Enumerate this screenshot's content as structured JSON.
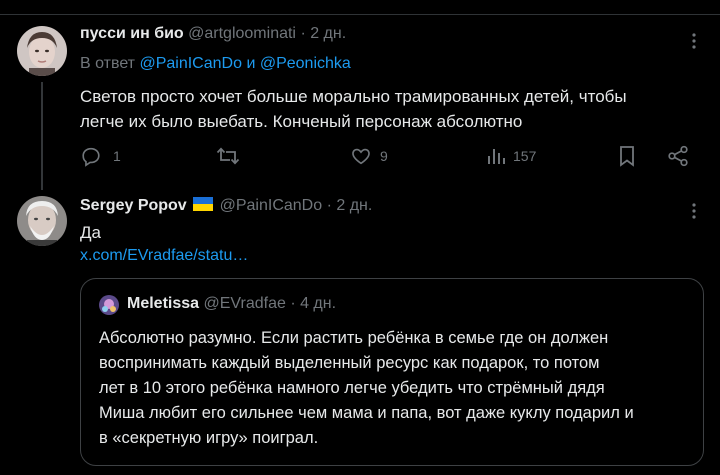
{
  "tweet1": {
    "author_name": "пусси ин био",
    "handle": "@artgloominati",
    "time": "· 2 дн.",
    "reply_prefix": "В ответ",
    "reply_user1": "@PainICanDo",
    "reply_and": "и",
    "reply_user2": "@Peonichka",
    "text_line1": "Светов просто хочет больше морально трамированных детей, чтобы",
    "text_line2": "легче их было выебать. Конченый персонаж абсолютно",
    "stats": {
      "replies": "1",
      "retweets": "",
      "likes": "9",
      "views": "157"
    }
  },
  "tweet2": {
    "author_name": "Sergey Popov",
    "handle": "@PainICanDo",
    "time": "· 2 дн.",
    "text": "Да",
    "link": "x.com/EVradfae/statu…",
    "quote": {
      "author_name": "Meletissa",
      "handle": "@EVradfae",
      "time": "· 4 дн.",
      "lines": [
        "Абсолютно разумно. Если растить ребёнка в семье где он должен",
        "воспринимать каждый выделенный ресурс как подарок, то потом",
        "лет в 10 этого ребёнка намного легче убедить что стрёмный дядя",
        "Миша любит его сильнее чем мама и папа, вот даже куклу подарил и",
        "в «секретную игру» поиграл."
      ]
    }
  },
  "colors": {
    "background": "#000000",
    "text": "#e7e9ea",
    "muted": "#71767b",
    "link": "#1d9bf0",
    "border": "#2f3336"
  },
  "icons": [
    "reply-icon",
    "retweet-icon",
    "like-icon",
    "views-icon",
    "bookmark-icon",
    "share-icon",
    "more-icon",
    "ukraine-flag-icon"
  ]
}
